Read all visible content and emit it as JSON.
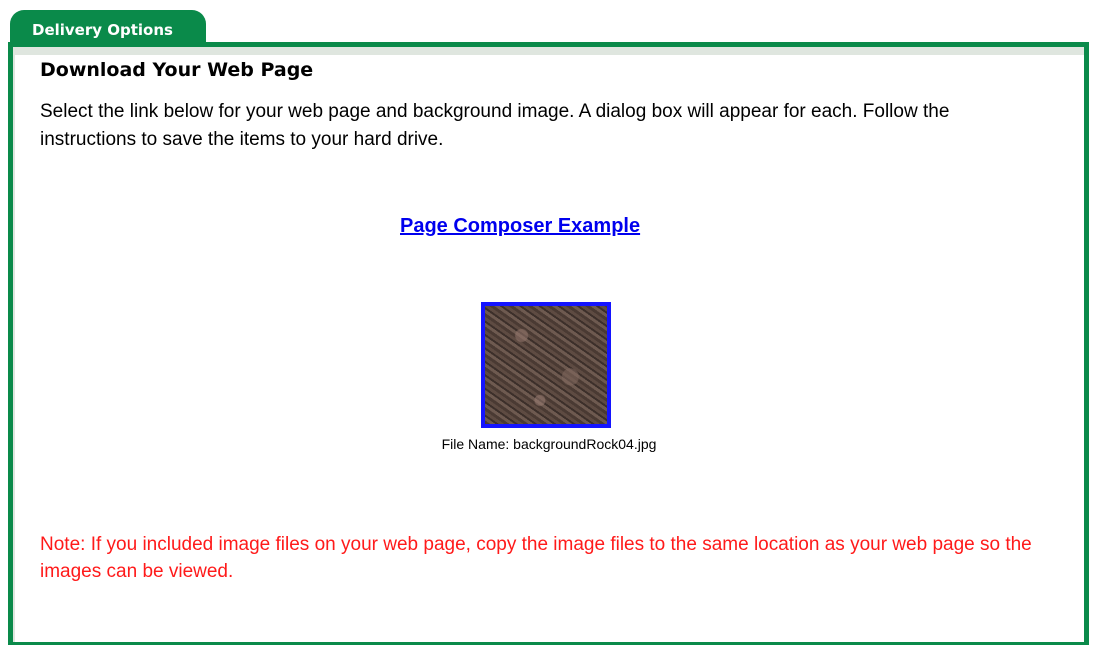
{
  "tab": {
    "label": "Delivery Options"
  },
  "content": {
    "heading": "Download Your Web Page",
    "description": "Select the link below for your web page and background image. A dialog box will appear for each. Follow the instructions to save the items to your hard drive.",
    "page_link_label": "Page Composer Example",
    "image_caption": "File Name: backgroundRock04.jpg",
    "note": "Note: If you included image files on your web page, copy the image files to the same location as your web page so the images can be viewed."
  },
  "colors": {
    "accent_green": "#0a8a4a",
    "link_blue": "#0000ee",
    "thumbnail_border": "#1414ff",
    "note_red": "#ff1a1a"
  }
}
